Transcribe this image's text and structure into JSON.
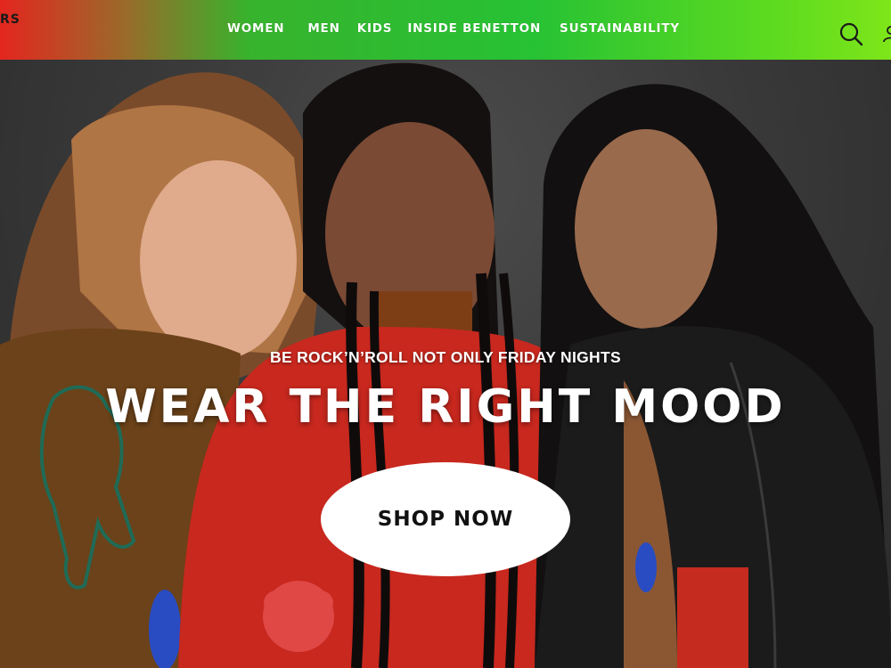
{
  "header": {
    "logo_fragment": "RS",
    "nav": [
      {
        "label": "WOMEN"
      },
      {
        "label": "MEN"
      },
      {
        "label": "KIDS"
      },
      {
        "label": "INSIDE BENETTON"
      },
      {
        "label": "SUSTAINABILITY"
      }
    ],
    "icons": {
      "search": "search-icon",
      "account": "user-icon"
    }
  },
  "hero": {
    "tagline": "BE ROCK’N’ROLL NOT ONLY FRIDAY NIGHTS",
    "headline": "WEAR THE RIGHT MOOD",
    "cta_label": "SHOP NOW"
  },
  "colors": {
    "header_gradient_start": "#e4261f",
    "header_gradient_mid": "#27c234",
    "header_gradient_end": "#7ee61a",
    "nav_text": "#ffffff",
    "cta_background": "#ffffff",
    "cta_text": "#111111"
  }
}
